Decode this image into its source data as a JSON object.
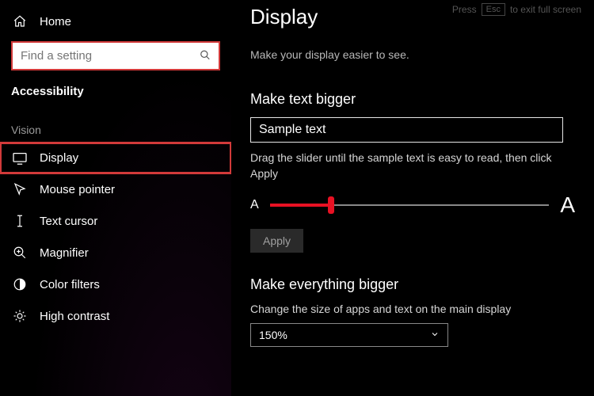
{
  "hint": {
    "prefix": "Press",
    "key": "Esc",
    "suffix": "to exit full screen"
  },
  "sidebar": {
    "home": "Home",
    "search_placeholder": "Find a setting",
    "category": "Accessibility",
    "group": "Vision",
    "items": [
      {
        "label": "Display"
      },
      {
        "label": "Mouse pointer"
      },
      {
        "label": "Text cursor"
      },
      {
        "label": "Magnifier"
      },
      {
        "label": "Color filters"
      },
      {
        "label": "High contrast"
      }
    ]
  },
  "main": {
    "title": "Display",
    "subtitle": "Make your display easier to see.",
    "text_bigger": {
      "heading": "Make text bigger",
      "sample": "Sample text",
      "desc": "Drag the slider until the sample text is easy to read, then click Apply",
      "letter": "A",
      "apply": "Apply"
    },
    "everything": {
      "heading": "Make everything bigger",
      "desc": "Change the size of apps and text on the main display",
      "value": "150%"
    }
  }
}
